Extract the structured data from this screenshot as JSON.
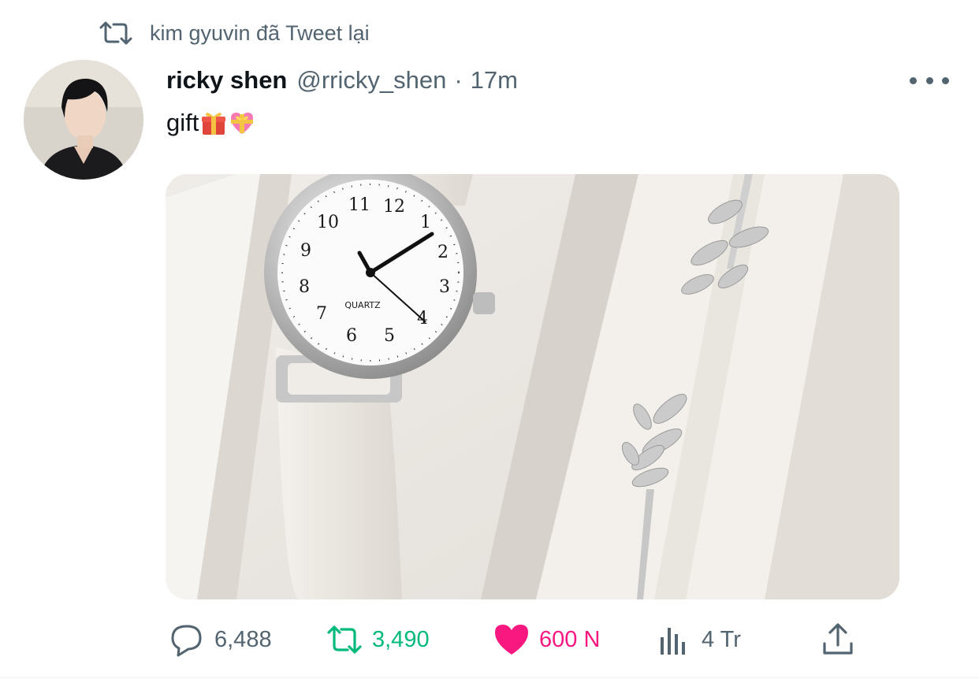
{
  "retweet_context": {
    "icon": "retweet-icon",
    "text": "kim gyuvin đã Tweet lại"
  },
  "tweet": {
    "author_name": "ricky shen",
    "handle": "@rricky_shen",
    "separator": "·",
    "time": "17m",
    "text": "gift",
    "emojis": [
      "gift-emoji",
      "heart-with-ribbon-emoji"
    ],
    "media": {
      "watch_dial_label": "QUARTZ",
      "dial_numbers": [
        "12",
        "1",
        "2",
        "3",
        "4",
        "5",
        "6",
        "7",
        "8",
        "9",
        "10",
        "11"
      ]
    }
  },
  "actions": {
    "reply_count": "6,488",
    "retweet_count": "3,490",
    "like_count": "600 N",
    "views_count": "4 Tr"
  },
  "colors": {
    "retweet_green": "#00ba7c",
    "like_pink": "#f91880",
    "secondary_text": "#536471"
  }
}
